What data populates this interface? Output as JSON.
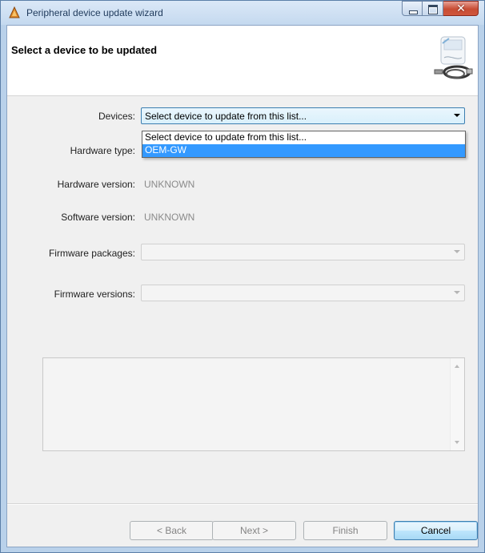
{
  "window": {
    "title": "Peripheral device update wizard"
  },
  "header": {
    "title": "Select a device to be updated"
  },
  "form": {
    "devices": {
      "label": "Devices:",
      "value": "Select device to update from this list...",
      "options": [
        "Select device to update from this list...",
        "OEM-GW"
      ],
      "highlighted_option": "OEM-GW"
    },
    "hardware_type": {
      "label": "Hardware type:",
      "value": ""
    },
    "hardware_version": {
      "label": "Hardware version:",
      "value": "UNKNOWN"
    },
    "software_version": {
      "label": "Software version:",
      "value": "UNKNOWN"
    },
    "firmware_packages": {
      "label": "Firmware packages:",
      "value": ""
    },
    "firmware_versions": {
      "label": "Firmware versions:",
      "value": ""
    }
  },
  "buttons": {
    "back": "< Back",
    "next": "Next >",
    "finish": "Finish",
    "cancel": "Cancel"
  },
  "colors": {
    "selection": "#3399ff",
    "default_button_border": "#3c7fb1"
  }
}
